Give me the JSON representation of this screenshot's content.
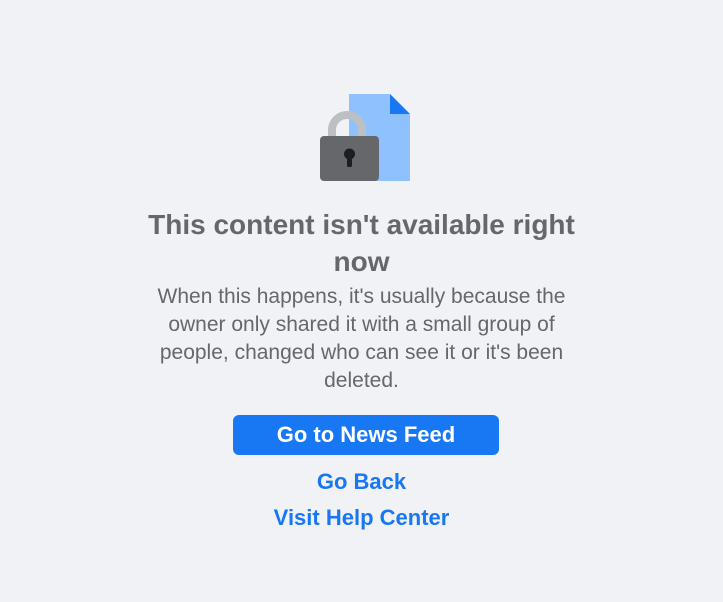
{
  "error": {
    "title": "This content isn't available right now",
    "message": "When this happens, it's usually because the owner only shared it with a small group of people, changed who can see it or it's been deleted.",
    "primary_button_label": "Go to News Feed",
    "go_back_label": "Go Back",
    "help_link_label": "Visit Help Center"
  },
  "icons": {
    "illustration": "locked-document-icon"
  },
  "colors": {
    "background": "#f0f2f5",
    "text_secondary": "#65676b",
    "accent": "#1877f2",
    "document_light": "#8fc1ff",
    "lock_body": "#65676b",
    "lock_shackle": "#bcc0c4"
  }
}
